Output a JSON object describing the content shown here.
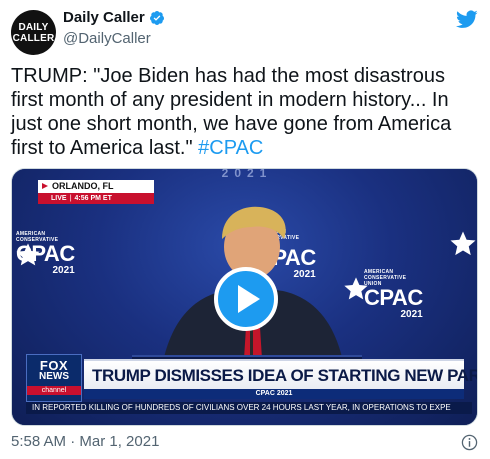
{
  "author": {
    "display_name": "Daily Caller",
    "handle": "@DailyCaller",
    "avatar_line1": "DAILY",
    "avatar_line2": "CALLER",
    "verified": true
  },
  "tweet": {
    "text": "TRUMP: \"Joe Biden has had the most disastrous first month of any president in modern history... In just one short month, we have gone from America first to America last.\"",
    "hashtag": "#CPAC",
    "timestamp": "5:58 AM · Mar 1, 2021"
  },
  "video": {
    "location": "ORLANDO, FL",
    "live_label": "LIVE",
    "live_time": "4:56 PM ET",
    "top_banner": "2021",
    "headline": "TRUMP DISMISSES IDEA OF STARTING NEW PARTY",
    "subheadline": "CPAC 2021",
    "ticker": "IN REPORTED KILLING OF HUNDREDS OF CIVILIANS OVER 24 HOURS LAST YEAR, IN OPERATIONS TO EXPE",
    "network_line1": "FOX",
    "network_line2": "NEWS",
    "network_line3": "channel",
    "backdrop_logo": {
      "org_line1": "AMERICAN",
      "org_line2": "CONSERVATIVE",
      "org_line3": "UNION",
      "name": "CPAC",
      "year": "2021"
    }
  },
  "colors": {
    "text_primary": "#0f1419",
    "text_secondary": "#536471",
    "link": "#1d9bf0",
    "fox_red": "#c8102e",
    "stage_blue": "#1a3080"
  },
  "icons": {
    "verified": "verified-badge-icon",
    "twitter": "twitter-bird-icon",
    "play": "play-icon",
    "info": "info-icon"
  }
}
